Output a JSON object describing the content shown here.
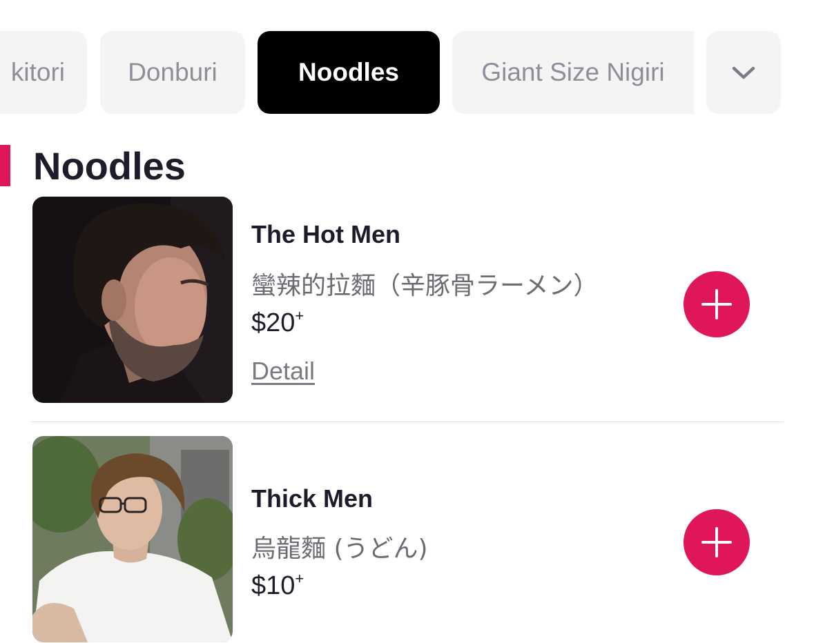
{
  "category_tabs": [
    {
      "label": "kitori",
      "active": false
    },
    {
      "label": "Donburi",
      "active": false
    },
    {
      "label": "Noodles",
      "active": true
    },
    {
      "label": "Giant Size Nigiri",
      "active": false
    }
  ],
  "more_icon": "chevron-down-icon",
  "section": {
    "title": "Noodles",
    "accent_color": "#e0165a"
  },
  "items": [
    {
      "name": "The Hot Men",
      "description": "蠻辣的拉麵（辛豚骨ラーメン）",
      "price": "$20",
      "price_suffix": "+",
      "detail_link": "Detail",
      "image_desc_icon": "photo-man-dark-hair-icon"
    },
    {
      "name": "Thick Men",
      "description": "烏龍麵 (うどん)",
      "price": "$10",
      "price_suffix": "+",
      "image_desc_icon": "photo-man-glasses-icon"
    }
  ],
  "add_icon": "plus-icon",
  "colors": {
    "accent": "#e0165a",
    "active_tab": "#000000",
    "tab_bg": "#f4f4f5"
  }
}
